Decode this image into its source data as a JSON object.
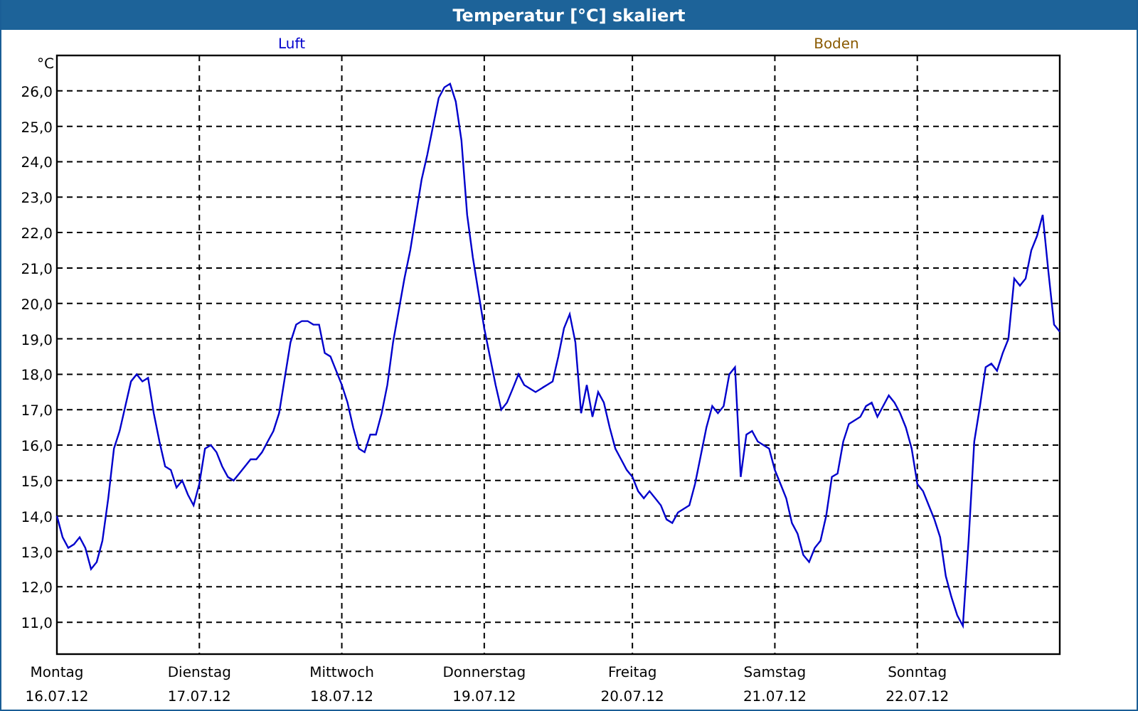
{
  "legend": [
    {
      "name": "Boden",
      "color": "#8a5a00"
    }
  ],
  "x_axis_dates": [
    "16.07.12",
    "17.07.12",
    "18.07.12",
    "19.07.12",
    "20.07.12",
    "21.07.12",
    "22.07.12"
  ],
  "chart_data": {
    "type": "line",
    "title": "Temperatur [°C] skaliert",
    "ylabel": "°C",
    "grid": true,
    "ylim": [
      10.1,
      27.0
    ],
    "categories": [
      "Montag",
      null,
      null,
      null,
      null,
      null,
      null,
      null,
      null,
      null,
      null,
      null,
      null,
      null,
      null,
      null,
      null,
      null,
      null,
      null,
      null,
      null,
      null,
      null,
      null,
      "Dienstag",
      null,
      null,
      null,
      null,
      null,
      null,
      null,
      null,
      null,
      null,
      null,
      null,
      null,
      null,
      null,
      null,
      null,
      null,
      null,
      null,
      null,
      null,
      null,
      null,
      "Mittwoch",
      null,
      null,
      null,
      null,
      null,
      null,
      null,
      null,
      null,
      null,
      null,
      null,
      null,
      null,
      null,
      null,
      null,
      null,
      null,
      null,
      null,
      null,
      null,
      null,
      "Donnerstag",
      null,
      null,
      null,
      null,
      null,
      null,
      null,
      null,
      null,
      null,
      null,
      null,
      null,
      null,
      null,
      null,
      null,
      null,
      null,
      null,
      null,
      null,
      null,
      null,
      null,
      "Freitag",
      null,
      null,
      null,
      null,
      null,
      null,
      null,
      null,
      null,
      null,
      null,
      null,
      null,
      null,
      null,
      null,
      null,
      null,
      null,
      null,
      null,
      null,
      null,
      null,
      "Samstag",
      null,
      null,
      null,
      null,
      null,
      null,
      null,
      null,
      null,
      null,
      null,
      null,
      null,
      null,
      null,
      null,
      null,
      null,
      null,
      null,
      null,
      null,
      null,
      null,
      "Sonntag",
      null,
      null,
      null,
      null,
      null,
      null,
      null,
      null,
      null,
      null,
      null,
      null,
      null,
      null,
      null,
      null,
      null,
      null,
      null,
      null,
      null,
      null,
      null,
      null,
      null
    ],
    "yticks": [
      {
        "value": 11,
        "label": "11,0"
      },
      {
        "value": 12,
        "label": "12,0"
      },
      {
        "value": 13,
        "label": "13,0"
      },
      {
        "value": 14,
        "label": "14,0"
      },
      {
        "value": 15,
        "label": "15,0"
      },
      {
        "value": 16,
        "label": "16,0"
      },
      {
        "value": 17,
        "label": "17,0"
      },
      {
        "value": 18,
        "label": "18,0"
      },
      {
        "value": 19,
        "label": "19,0"
      },
      {
        "value": 20,
        "label": "20,0"
      },
      {
        "value": 21,
        "label": "21,0"
      },
      {
        "value": 22,
        "label": "22,0"
      },
      {
        "value": 23,
        "label": "23,0"
      },
      {
        "value": 24,
        "label": "24,0"
      },
      {
        "value": 25,
        "label": "25,0"
      },
      {
        "value": 26,
        "label": "26,0"
      }
    ],
    "series": [
      {
        "name": "Luft",
        "color": "#0000cc",
        "values": [
          14.0,
          13.4,
          13.1,
          13.2,
          13.4,
          13.1,
          12.5,
          12.7,
          13.3,
          14.5,
          15.9,
          16.4,
          17.1,
          17.8,
          18.0,
          17.8,
          17.9,
          16.9,
          16.1,
          15.4,
          15.3,
          14.8,
          15.0,
          14.6,
          14.3,
          14.9,
          15.9,
          16.0,
          15.8,
          15.4,
          15.1,
          15.0,
          15.2,
          15.4,
          15.6,
          15.6,
          15.8,
          16.1,
          16.4,
          16.9,
          17.9,
          18.9,
          19.4,
          19.5,
          19.5,
          19.4,
          19.4,
          18.6,
          18.5,
          18.1,
          17.7,
          17.2,
          16.5,
          15.9,
          15.8,
          16.3,
          16.3,
          16.9,
          17.7,
          18.9,
          19.8,
          20.7,
          21.5,
          22.5,
          23.5,
          24.2,
          25.0,
          25.8,
          26.1,
          26.2,
          25.7,
          24.6,
          22.5,
          21.3,
          20.3,
          19.3,
          18.5,
          17.7,
          17.0,
          17.2,
          17.6,
          18.0,
          17.7,
          17.6,
          17.5,
          17.6,
          17.7,
          17.8,
          18.5,
          19.3,
          19.7,
          18.9,
          16.9,
          17.7,
          16.8,
          17.5,
          17.2,
          16.5,
          15.9,
          15.6,
          15.3,
          15.1,
          14.7,
          14.5,
          14.7,
          14.5,
          14.3,
          13.9,
          13.8,
          14.1,
          14.2,
          14.3,
          14.9,
          15.7,
          16.5,
          17.1,
          16.9,
          17.1,
          18.0,
          18.2,
          15.1,
          16.3,
          16.4,
          16.1,
          16.0,
          15.9,
          15.3,
          14.9,
          14.5,
          13.8,
          13.5,
          12.9,
          12.7,
          13.1,
          13.3,
          14.0,
          15.1,
          15.2,
          16.1,
          16.6,
          16.7,
          16.8,
          17.1,
          17.2,
          16.8,
          17.1,
          17.4,
          17.2,
          16.9,
          16.5,
          15.9,
          14.9,
          14.7,
          14.3,
          13.9,
          13.4,
          12.3,
          11.7,
          11.2,
          10.9,
          13.3,
          16.1,
          17.1,
          18.2,
          18.3,
          18.1,
          18.6,
          19.0,
          20.7,
          20.5,
          20.7,
          21.5,
          21.9,
          22.5,
          20.9,
          19.4,
          19.2
        ]
      }
    ]
  }
}
